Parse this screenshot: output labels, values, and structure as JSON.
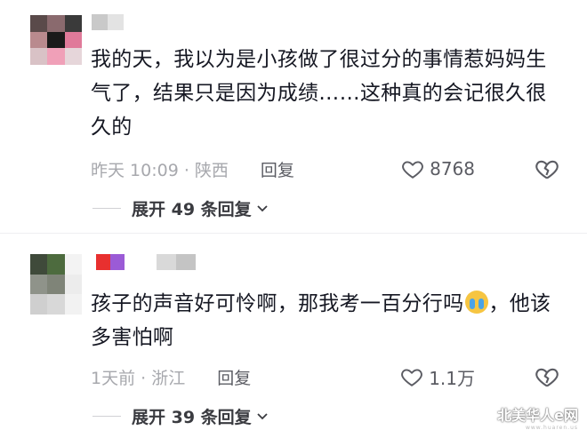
{
  "comments": [
    {
      "text": "我的天，我以为是小孩做了很过分的事情惹妈妈生气了，结果只是因为成绩……这种真的会记很久很久的",
      "time": "昨天 10:09 · 陕西",
      "reply_label": "回复",
      "likes": "8768",
      "expand_label": "展开 49 条回复",
      "avatar_colors": [
        "#5a4a4a",
        "#8a6a6e",
        "#3a3a3a",
        "#b98a8e",
        "#1a1a1a",
        "#e07a9a",
        "#d9c2c6",
        "#f0a0b8",
        "#e6d6da"
      ],
      "username_colors": [
        "#c9c9c9",
        "#e3e3e3"
      ]
    },
    {
      "text": "孩子的声音好可怜啊，那我考一百分行吗",
      "text_after_emoji": "，他该多害怕啊",
      "emoji": "loudly-crying-face-icon",
      "time": "1天前 · 浙江",
      "reply_label": "回复",
      "likes": "1.1万",
      "expand_label": "展开 39 条回复",
      "avatar_colors": [
        "#3f4a3a",
        "#4d6b3e",
        "#f3f3f3",
        "#8f938a",
        "#7f8478",
        "#ececec",
        "#cfcfcf",
        "#d8d8d8",
        "#f2f2f2"
      ],
      "username_colors": [
        "#e8302f",
        "#9b5bd6",
        "#d9d9d9",
        "#c4c4c4"
      ]
    }
  ],
  "watermark": {
    "main": "北美华人e网",
    "sub": "www.huaren.us"
  }
}
